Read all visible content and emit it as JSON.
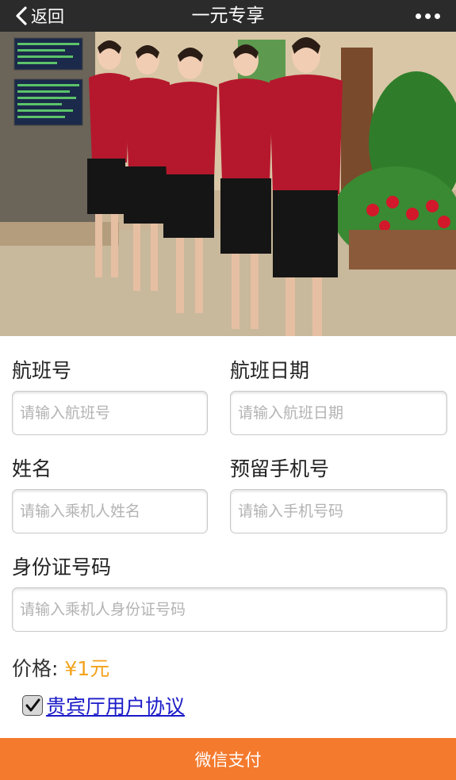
{
  "nav": {
    "back_label": "返回",
    "title": "一元专享"
  },
  "form": {
    "flight_no": {
      "label": "航班号",
      "placeholder": "请输入航班号"
    },
    "flight_date": {
      "label": "航班日期",
      "placeholder": "请输入航班日期"
    },
    "name": {
      "label": "姓名",
      "placeholder": "请输入乘机人姓名"
    },
    "phone": {
      "label": "预留手机号",
      "placeholder": "请输入手机号码"
    },
    "id_no": {
      "label": "身份证号码",
      "placeholder": "请输入乘机人身份证号码"
    }
  },
  "price": {
    "label": "价格:",
    "value": "¥1元"
  },
  "agreement": {
    "checked": true,
    "link_text": "贵宾厅用户协议"
  },
  "pay_button": {
    "label": "微信支付"
  },
  "colors": {
    "nav_bg": "#2b2b2b",
    "price": "#f3a31d",
    "pay_bg": "#f47a2e",
    "link": "#1a1ac8"
  }
}
